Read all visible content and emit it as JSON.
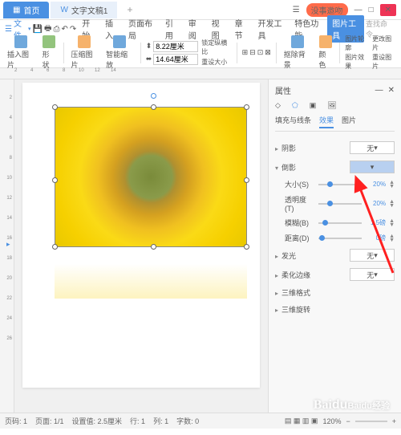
{
  "tabs": {
    "home": "首页",
    "doc": "文字文稿1"
  },
  "winbtns": {
    "feedback": "没事邀吻"
  },
  "menu": {
    "file": "文件",
    "items": [
      "开始",
      "插入",
      "页面布局",
      "引用",
      "审阅",
      "视图",
      "章节",
      "开发工具",
      "特色功能"
    ],
    "active": "图片工具",
    "search": "查找命令…"
  },
  "toolbar": {
    "insert_pic": "插入图片",
    "shape": "形状",
    "compress": "压缩图片",
    "smart_zoom": "智能缩放",
    "width": "8.22厘米",
    "height": "14.64厘米",
    "lock_ratio": "锁定纵横比",
    "reset_size": "重设大小",
    "edit_pic": "抠除背景",
    "color": "颜色",
    "pic_outline": "图片轮廓",
    "pic_effect": "图片效果",
    "change_pic": "更改图片",
    "reset_pic": "重设图片"
  },
  "panel": {
    "title": "属性",
    "subtab1": "填充与线条",
    "subtab2": "效果",
    "subtab3": "图片",
    "shadow": "阴影",
    "reflection": "倒影",
    "glow": "发光",
    "soft_edge": "柔化边缘",
    "three_d_format": "三维格式",
    "three_d_rotate": "三维旋转",
    "none": "无",
    "size": "大小(S)",
    "transparency": "透明度(T)",
    "blur": "模糊(B)",
    "distance": "距离(D)",
    "size_val": "20%",
    "trans_val": "20%",
    "blur_val": "1.5磅",
    "dist_val": "0磅"
  },
  "status": {
    "page": "页码: 1",
    "pages": "页面: 1/1",
    "section": "设置值: 2.5厘米",
    "row": "行: 1",
    "col": "列: 1",
    "words": "字数: 0",
    "zoom": "120%"
  },
  "watermark": "Baidu经验"
}
